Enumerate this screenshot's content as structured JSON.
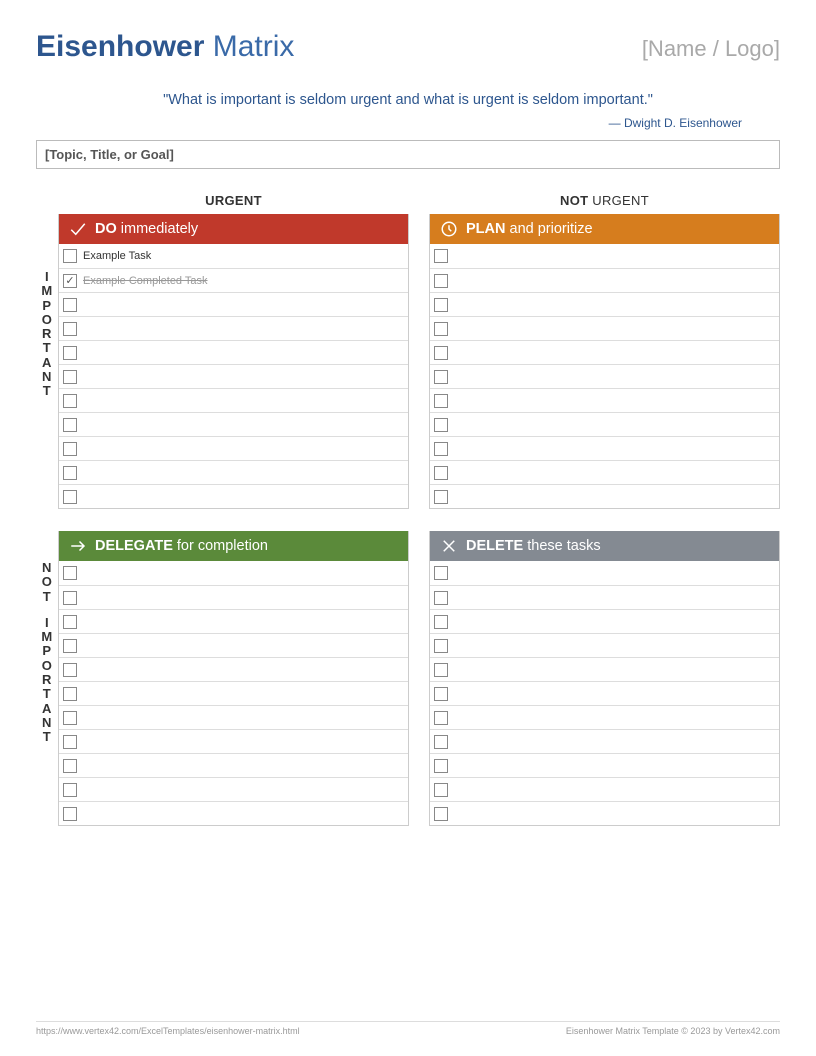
{
  "header": {
    "title_bold": "Eisenhower",
    "title_light": " Matrix",
    "name_logo": "[Name / Logo]"
  },
  "quote": {
    "text": "\"What is important is seldom urgent and what is urgent is seldom important.\"",
    "attribution": "— Dwight D. Eisenhower"
  },
  "topic_placeholder": "[Topic, Title, or Goal]",
  "columns": {
    "urgent": "URGENT",
    "not_bold": "NOT",
    "not_urgent_light": " URGENT"
  },
  "rows": {
    "important": "IMPORTANT",
    "not": "NOT",
    "not_important": "IMPORTANT"
  },
  "quadrants": {
    "do": {
      "bold": "DO",
      "rest": " immediately"
    },
    "plan": {
      "bold": "PLAN",
      "rest": " and prioritize"
    },
    "delegate": {
      "bold": "DELEGATE",
      "rest": " for completion"
    },
    "delete": {
      "bold": "DELETE",
      "rest": " these tasks"
    }
  },
  "tasks": {
    "do": [
      {
        "text": "Example Task",
        "done": false
      },
      {
        "text": "Example Completed Task",
        "done": true
      },
      {
        "text": ""
      },
      {
        "text": ""
      },
      {
        "text": ""
      },
      {
        "text": ""
      },
      {
        "text": ""
      },
      {
        "text": ""
      },
      {
        "text": ""
      },
      {
        "text": ""
      },
      {
        "text": ""
      }
    ],
    "plan": [
      {
        "text": ""
      },
      {
        "text": ""
      },
      {
        "text": ""
      },
      {
        "text": ""
      },
      {
        "text": ""
      },
      {
        "text": ""
      },
      {
        "text": ""
      },
      {
        "text": ""
      },
      {
        "text": ""
      },
      {
        "text": ""
      },
      {
        "text": ""
      }
    ],
    "delegate": [
      {
        "text": ""
      },
      {
        "text": ""
      },
      {
        "text": ""
      },
      {
        "text": ""
      },
      {
        "text": ""
      },
      {
        "text": ""
      },
      {
        "text": ""
      },
      {
        "text": ""
      },
      {
        "text": ""
      },
      {
        "text": ""
      },
      {
        "text": ""
      }
    ],
    "delete": [
      {
        "text": ""
      },
      {
        "text": ""
      },
      {
        "text": ""
      },
      {
        "text": ""
      },
      {
        "text": ""
      },
      {
        "text": ""
      },
      {
        "text": ""
      },
      {
        "text": ""
      },
      {
        "text": ""
      },
      {
        "text": ""
      },
      {
        "text": ""
      }
    ]
  },
  "footer": {
    "url": "https://www.vertex42.com/ExcelTemplates/eisenhower-matrix.html",
    "copyright": "Eisenhower Matrix Template © 2023 by Vertex42.com"
  }
}
